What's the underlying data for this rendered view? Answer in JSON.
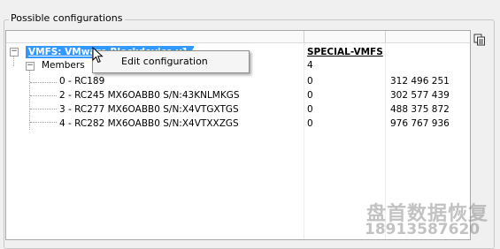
{
  "group": {
    "title": "Possible configurations"
  },
  "tree": {
    "root": {
      "label": "VMFS: VMware Blockdevice v1.0",
      "type": "SPECIAL-VMFS"
    },
    "members": {
      "label": "Members",
      "count": "4"
    },
    "disks": [
      {
        "label": "0 - RC189",
        "value": "0",
        "size": "312 496 251"
      },
      {
        "label": "2 - RC245 MX6OABB0 S/N:43KNLMKGS",
        "value": "0",
        "size": "302 577 439"
      },
      {
        "label": "3 - RC277 MX6OABB0 S/N:X4VTGXTGS",
        "value": "0",
        "size": "488 375 872"
      },
      {
        "label": "4 - RC282 MX6OABB0 S/N:X4VTXXZGS",
        "value": "0",
        "size": "976 767 936"
      }
    ]
  },
  "context_menu": {
    "items": [
      {
        "label": "Edit configuration"
      }
    ]
  },
  "icons": {
    "copy": "copy-icon",
    "cursor": "mouse-pointer-icon"
  },
  "watermark": {
    "chinese": "盘首数据恢复",
    "phone": "18913587620"
  },
  "colors": {
    "selection": "#3399ff",
    "menu_bg": "#f5f5f5"
  }
}
